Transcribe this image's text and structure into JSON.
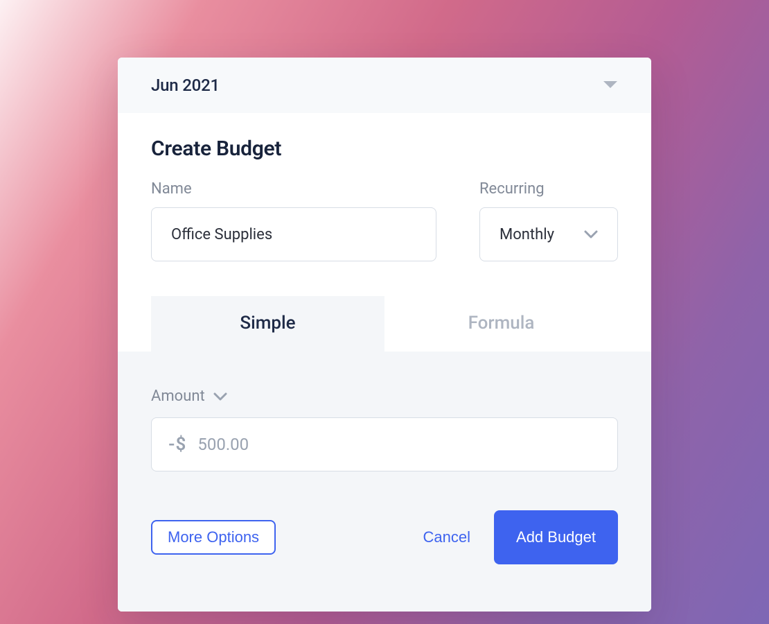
{
  "header": {
    "month": "Jun 2021"
  },
  "page": {
    "title": "Create Budget"
  },
  "fields": {
    "name": {
      "label": "Name",
      "value": "Office Supplies"
    },
    "recurring": {
      "label": "Recurring",
      "value": "Monthly"
    },
    "amount": {
      "label": "Amount",
      "prefix": "-$",
      "placeholder": "500.00",
      "value": ""
    }
  },
  "tabs": {
    "simple": "Simple",
    "formula": "Formula",
    "active": "simple"
  },
  "actions": {
    "more": "More Options",
    "cancel": "Cancel",
    "add": "Add Budget"
  }
}
